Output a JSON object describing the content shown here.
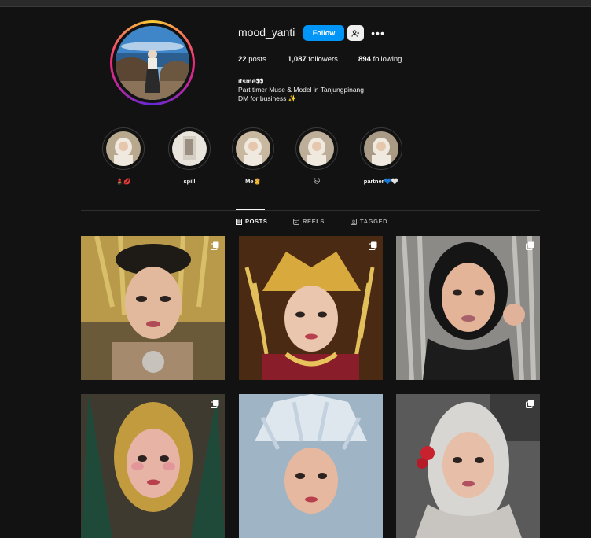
{
  "profile": {
    "username": "mood_yanti",
    "follow_label": "Follow",
    "more_label": "•••",
    "stats": {
      "posts": "22",
      "posts_label": " posts",
      "followers": "1,087",
      "followers_label": " followers",
      "following": "894",
      "following_label": " following"
    },
    "bio": {
      "name": "itsme👀",
      "line1": "Part timer Muse & Model in Tanjungpinang",
      "line2": "DM for business ✨"
    }
  },
  "highlights": [
    {
      "label": "💄💋"
    },
    {
      "label": "spill"
    },
    {
      "label": "Me👸"
    },
    {
      "label": "🐱"
    },
    {
      "label": "partner💙🤍"
    }
  ],
  "tabs": [
    {
      "label": "POSTS",
      "icon": "grid-icon"
    },
    {
      "label": "REELS",
      "icon": "reels-icon"
    },
    {
      "label": "TAGGED",
      "icon": "tagged-icon"
    }
  ],
  "colors": {
    "background": "#121212",
    "follow_button": "#0095f6",
    "gold": "#c9a23a"
  }
}
